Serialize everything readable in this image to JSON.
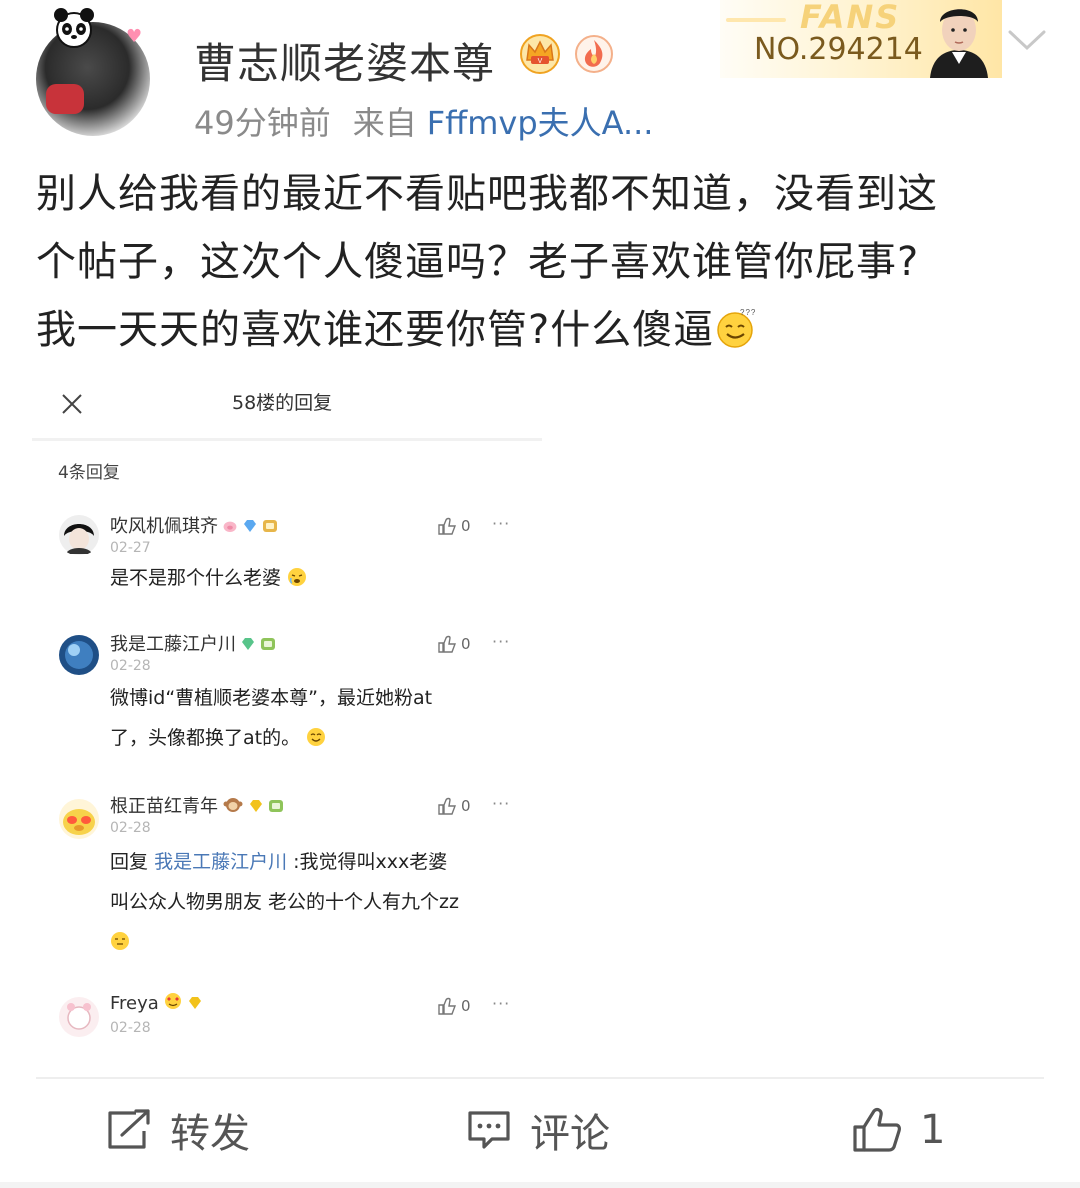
{
  "post": {
    "author": "曹志顺老婆本尊",
    "time": "49分钟前",
    "from_label": "来自",
    "source": "Fffmvp夫人A...",
    "fans_word": "FANS",
    "fans_number": "NO.294214",
    "body_lines": [
      "别人给我看的最近不看贴吧我都不知道，没看到这",
      "个帖子，这次个人傻逼吗？老子喜欢谁管你屁事?",
      "我一天天的喜欢谁还要你管?什么傻逼"
    ],
    "body_trailing_emoji": "smirk-emoji"
  },
  "screenshot": {
    "title": "58楼的回复",
    "count": "4条回复",
    "replies": [
      {
        "name": "吹风机佩琪齐",
        "date": "02-27",
        "likes": "0",
        "more": "···",
        "body": [
          "是不是那个什么老婆"
        ]
      },
      {
        "name": "我是工藤江户川",
        "date": "02-28",
        "likes": "0",
        "more": "···",
        "body": [
          "微博id“曹植顺老婆本尊”，最近她粉at",
          "了，头像都换了at的。"
        ]
      },
      {
        "name": "根正苗红青年",
        "date": "02-28",
        "likes": "0",
        "more": "···",
        "reply_prefix": "回复",
        "mention": "我是工藤江户川",
        "body": [
          ":我觉得叫xxx老婆",
          "叫公众人物男朋友 老公的十个人有九个zz"
        ]
      },
      {
        "name": "Freya",
        "date": "02-28",
        "likes": "0",
        "more": "···"
      }
    ]
  },
  "toolbar": {
    "repost_label": "转发",
    "comment_label": "评论",
    "like_count": "1"
  },
  "colors": {
    "link": "#3a6fb0",
    "meta": "#8a8a8a",
    "fans_gold": "#f6d27a"
  }
}
